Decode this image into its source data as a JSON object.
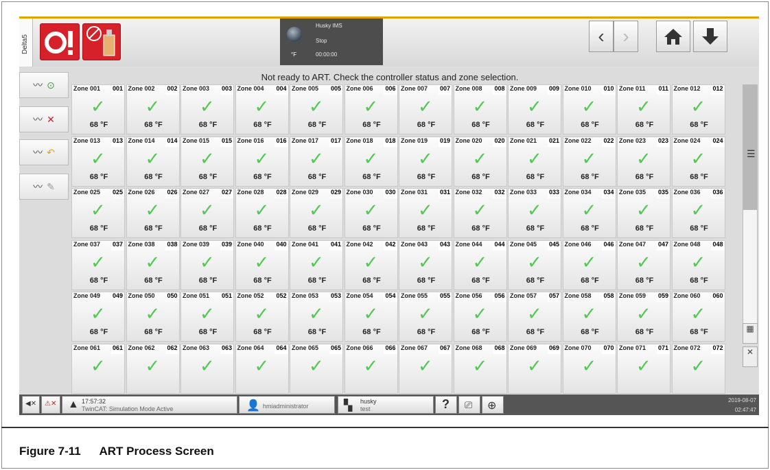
{
  "topbar": {
    "delta_tab": "Delta5",
    "ims_title": "Husky IMS",
    "ims_state": "Stop",
    "ims_time": "00:00:00",
    "temp_unit": "°F"
  },
  "message": "Not ready to ART. Check the controller status and zone selection.",
  "zones": [
    {
      "name": "Zone 001",
      "num": "001",
      "temp": "68 °F"
    },
    {
      "name": "Zone 002",
      "num": "002",
      "temp": "68 °F"
    },
    {
      "name": "Zone 003",
      "num": "003",
      "temp": "68 °F"
    },
    {
      "name": "Zone 004",
      "num": "004",
      "temp": "68 °F"
    },
    {
      "name": "Zone 005",
      "num": "005",
      "temp": "68 °F"
    },
    {
      "name": "Zone 006",
      "num": "006",
      "temp": "68 °F"
    },
    {
      "name": "Zone 007",
      "num": "007",
      "temp": "68 °F"
    },
    {
      "name": "Zone 008",
      "num": "008",
      "temp": "68 °F"
    },
    {
      "name": "Zone 009",
      "num": "009",
      "temp": "68 °F"
    },
    {
      "name": "Zone 010",
      "num": "010",
      "temp": "68 °F"
    },
    {
      "name": "Zone 011",
      "num": "011",
      "temp": "68 °F"
    },
    {
      "name": "Zone 012",
      "num": "012",
      "temp": "68 °F"
    },
    {
      "name": "Zone 013",
      "num": "013",
      "temp": "68 °F"
    },
    {
      "name": "Zone 014",
      "num": "014",
      "temp": "68 °F"
    },
    {
      "name": "Zone 015",
      "num": "015",
      "temp": "68 °F"
    },
    {
      "name": "Zone 016",
      "num": "016",
      "temp": "68 °F"
    },
    {
      "name": "Zone 017",
      "num": "017",
      "temp": "68 °F"
    },
    {
      "name": "Zone 018",
      "num": "018",
      "temp": "68 °F"
    },
    {
      "name": "Zone 019",
      "num": "019",
      "temp": "68 °F"
    },
    {
      "name": "Zone 020",
      "num": "020",
      "temp": "68 °F"
    },
    {
      "name": "Zone 021",
      "num": "021",
      "temp": "68 °F"
    },
    {
      "name": "Zone 022",
      "num": "022",
      "temp": "68 °F"
    },
    {
      "name": "Zone 023",
      "num": "023",
      "temp": "68 °F"
    },
    {
      "name": "Zone 024",
      "num": "024",
      "temp": "68 °F"
    },
    {
      "name": "Zone 025",
      "num": "025",
      "temp": "68 °F"
    },
    {
      "name": "Zone 026",
      "num": "026",
      "temp": "68 °F"
    },
    {
      "name": "Zone 027",
      "num": "027",
      "temp": "68 °F"
    },
    {
      "name": "Zone 028",
      "num": "028",
      "temp": "68 °F"
    },
    {
      "name": "Zone 029",
      "num": "029",
      "temp": "68 °F"
    },
    {
      "name": "Zone 030",
      "num": "030",
      "temp": "68 °F"
    },
    {
      "name": "Zone 031",
      "num": "031",
      "temp": "68 °F"
    },
    {
      "name": "Zone 032",
      "num": "032",
      "temp": "68 °F"
    },
    {
      "name": "Zone 033",
      "num": "033",
      "temp": "68 °F"
    },
    {
      "name": "Zone 034",
      "num": "034",
      "temp": "68 °F"
    },
    {
      "name": "Zone 035",
      "num": "035",
      "temp": "68 °F"
    },
    {
      "name": "Zone 036",
      "num": "036",
      "temp": "68 °F"
    },
    {
      "name": "Zone 037",
      "num": "037",
      "temp": "68 °F"
    },
    {
      "name": "Zone 038",
      "num": "038",
      "temp": "68 °F"
    },
    {
      "name": "Zone 039",
      "num": "039",
      "temp": "68 °F"
    },
    {
      "name": "Zone 040",
      "num": "040",
      "temp": "68 °F"
    },
    {
      "name": "Zone 041",
      "num": "041",
      "temp": "68 °F"
    },
    {
      "name": "Zone 042",
      "num": "042",
      "temp": "68 °F"
    },
    {
      "name": "Zone 043",
      "num": "043",
      "temp": "68 °F"
    },
    {
      "name": "Zone 044",
      "num": "044",
      "temp": "68 °F"
    },
    {
      "name": "Zone 045",
      "num": "045",
      "temp": "68 °F"
    },
    {
      "name": "Zone 046",
      "num": "046",
      "temp": "68 °F"
    },
    {
      "name": "Zone 047",
      "num": "047",
      "temp": "68 °F"
    },
    {
      "name": "Zone 048",
      "num": "048",
      "temp": "68 °F"
    },
    {
      "name": "Zone 049",
      "num": "049",
      "temp": "68 °F"
    },
    {
      "name": "Zone 050",
      "num": "050",
      "temp": "68 °F"
    },
    {
      "name": "Zone 051",
      "num": "051",
      "temp": "68 °F"
    },
    {
      "name": "Zone 052",
      "num": "052",
      "temp": "68 °F"
    },
    {
      "name": "Zone 053",
      "num": "053",
      "temp": "68 °F"
    },
    {
      "name": "Zone 054",
      "num": "054",
      "temp": "68 °F"
    },
    {
      "name": "Zone 055",
      "num": "055",
      "temp": "68 °F"
    },
    {
      "name": "Zone 056",
      "num": "056",
      "temp": "68 °F"
    },
    {
      "name": "Zone 057",
      "num": "057",
      "temp": "68 °F"
    },
    {
      "name": "Zone 058",
      "num": "058",
      "temp": "68 °F"
    },
    {
      "name": "Zone 059",
      "num": "059",
      "temp": "68 °F"
    },
    {
      "name": "Zone 060",
      "num": "060",
      "temp": "68 °F"
    },
    {
      "name": "Zone 061",
      "num": "061",
      "temp": ""
    },
    {
      "name": "Zone 062",
      "num": "062",
      "temp": ""
    },
    {
      "name": "Zone 063",
      "num": "063",
      "temp": ""
    },
    {
      "name": "Zone 064",
      "num": "064",
      "temp": ""
    },
    {
      "name": "Zone 065",
      "num": "065",
      "temp": ""
    },
    {
      "name": "Zone 066",
      "num": "066",
      "temp": ""
    },
    {
      "name": "Zone 067",
      "num": "067",
      "temp": ""
    },
    {
      "name": "Zone 068",
      "num": "068",
      "temp": ""
    },
    {
      "name": "Zone 069",
      "num": "069",
      "temp": ""
    },
    {
      "name": "Zone 070",
      "num": "070",
      "temp": ""
    },
    {
      "name": "Zone 071",
      "num": "071",
      "temp": ""
    },
    {
      "name": "Zone 072",
      "num": "072",
      "temp": ""
    }
  ],
  "scroll_position": 0,
  "bottombar": {
    "alarm_time": "17:57:32",
    "alarm_text": "TwinCAT: Simulation Mode Active",
    "user": "hmiadministrator",
    "mold_name": "husky",
    "mold_sub": "test",
    "date": "2019-08-07",
    "time": "02:47:47"
  },
  "caption": {
    "figure": "Figure 7-11",
    "title": "ART Process Screen"
  },
  "colors": {
    "accent": "#e0a400",
    "alarm_red": "#d6202a",
    "check_green": "#53c853"
  }
}
